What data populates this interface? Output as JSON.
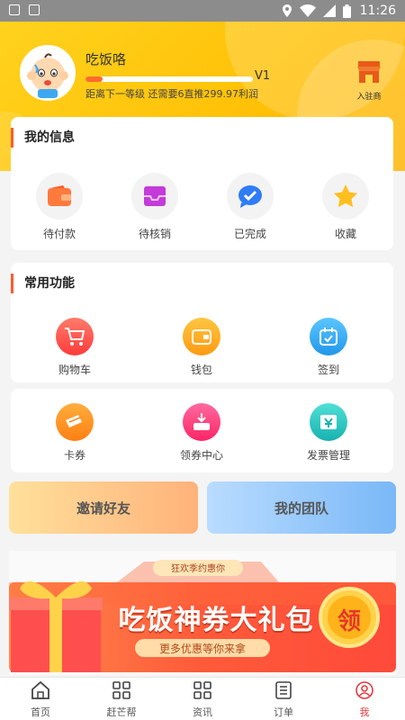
{
  "status_bar": {
    "time": "11:26",
    "left_icons": [
      "image-icon",
      "a-icon"
    ],
    "right_icons": [
      "location-icon",
      "wifi-icon",
      "signal-icon",
      "battery-icon"
    ]
  },
  "profile": {
    "name": "吃饭咯",
    "level": "V1",
    "level_progress": 0.1,
    "level_description": "距离下一等级 还需要6直推299.97利润",
    "shop_label": "入驻商"
  },
  "my_info": {
    "title": "我的信息",
    "items": [
      {
        "label": "待付款",
        "icon": "wallet-icon",
        "color": "#ff7a3d"
      },
      {
        "label": "待核销",
        "icon": "inbox-icon",
        "color": "#c43bd9"
      },
      {
        "label": "已完成",
        "icon": "chat-check-icon",
        "color": "#2f7cf6"
      },
      {
        "label": "收藏",
        "icon": "star-icon",
        "color": "#ffbf1f"
      }
    ]
  },
  "common": {
    "title": "常用功能",
    "items": [
      {
        "label": "购物车",
        "icon": "cart-icon",
        "color": "#ff4f4f"
      },
      {
        "label": "钱包",
        "icon": "wallet-icon",
        "color": "#ffad1f"
      },
      {
        "label": "签到",
        "icon": "calendar-check-icon",
        "color": "#2aa5ef"
      },
      {
        "label": "卡券",
        "icon": "ticket-icon",
        "color": "#ff9520"
      },
      {
        "label": "领券中心",
        "icon": "coupon-center-icon",
        "color": "#ff3d7f"
      },
      {
        "label": "发票管理",
        "icon": "invoice-icon",
        "color": "#22c6c0"
      }
    ]
  },
  "actions": {
    "invite": "邀请好友",
    "team": "我的团队"
  },
  "banner": {
    "tag": "狂欢季约惠你",
    "title": "吃饭神券大礼包",
    "subtitle": "更多优惠等你来拿",
    "button": "领"
  },
  "tabs": [
    {
      "label": "首页",
      "icon": "home-icon",
      "active": false
    },
    {
      "label": "赶芒帮",
      "icon": "grid-icon",
      "active": false
    },
    {
      "label": "资讯",
      "icon": "grid-icon",
      "active": false
    },
    {
      "label": "订单",
      "icon": "list-icon",
      "active": false
    },
    {
      "label": "我",
      "icon": "user-icon",
      "active": true
    }
  ]
}
